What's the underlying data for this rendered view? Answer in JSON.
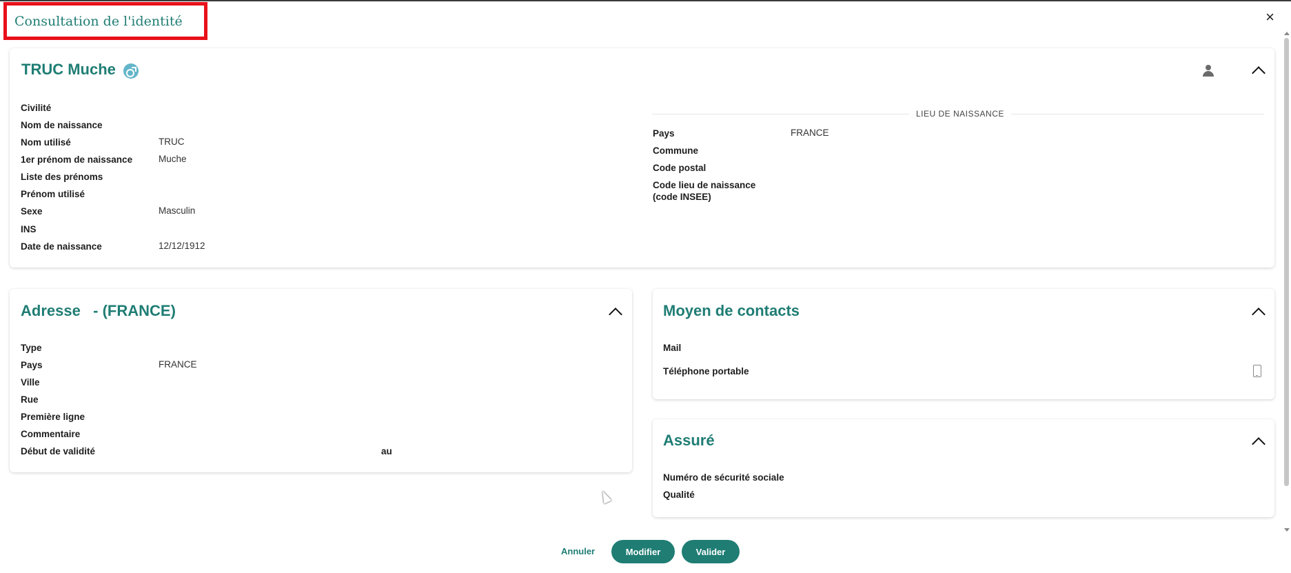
{
  "modal": {
    "title": "Consultation de l'identité",
    "close_label": "×"
  },
  "identity": {
    "name": "TRUC Muche",
    "gender_icon": "male-symbol-icon",
    "profile_icon": "person-icon",
    "left_fields": [
      {
        "label": "Civilité",
        "value": ""
      },
      {
        "label": "Nom de naissance",
        "value": ""
      },
      {
        "label": "Nom utilisé",
        "value": "TRUC"
      },
      {
        "label": "1er prénom de naissance",
        "value": "Muche"
      },
      {
        "label": "Liste des prénoms",
        "value": ""
      },
      {
        "label": "Prénom utilisé",
        "value": ""
      },
      {
        "label": "Sexe",
        "value": "Masculin"
      },
      {
        "label": "INS",
        "value": ""
      },
      {
        "label": "Date de naissance",
        "value": "12/12/1912"
      }
    ],
    "birthplace_section": "LIEU DE NAISSANCE",
    "right_fields": [
      {
        "label": "Pays",
        "value": "FRANCE"
      },
      {
        "label": "Commune",
        "value": ""
      },
      {
        "label": "Code postal",
        "value": ""
      },
      {
        "label": "Code lieu de naissance\n(code INSEE)",
        "value": ""
      }
    ]
  },
  "address": {
    "title": "Adresse   - (FRANCE)",
    "fields": [
      {
        "label": "Type",
        "value": ""
      },
      {
        "label": "Pays",
        "value": "FRANCE"
      },
      {
        "label": "Ville",
        "value": ""
      },
      {
        "label": "Rue",
        "value": ""
      },
      {
        "label": "Première ligne",
        "value": ""
      },
      {
        "label": "Commentaire",
        "value": ""
      },
      {
        "label": "Début de validité",
        "value": ""
      }
    ],
    "validity_to_label": "au"
  },
  "contacts": {
    "title": "Moyen de contacts",
    "fields": [
      {
        "label": "Mail",
        "value": ""
      },
      {
        "label": "Téléphone portable",
        "value": ""
      }
    ],
    "phone_icon": "mobile-phone-icon"
  },
  "insured": {
    "title": "Assuré",
    "fields": [
      {
        "label": "Numéro de sécurité sociale",
        "value": ""
      },
      {
        "label": "Qualité",
        "value": ""
      }
    ]
  },
  "actions": {
    "cancel": "Annuler",
    "modify": "Modifier",
    "validate": "Valider"
  },
  "colors": {
    "accent": "#1f7d74",
    "highlight_border": "#e8101a",
    "gender_badge": "#63b6c9"
  }
}
